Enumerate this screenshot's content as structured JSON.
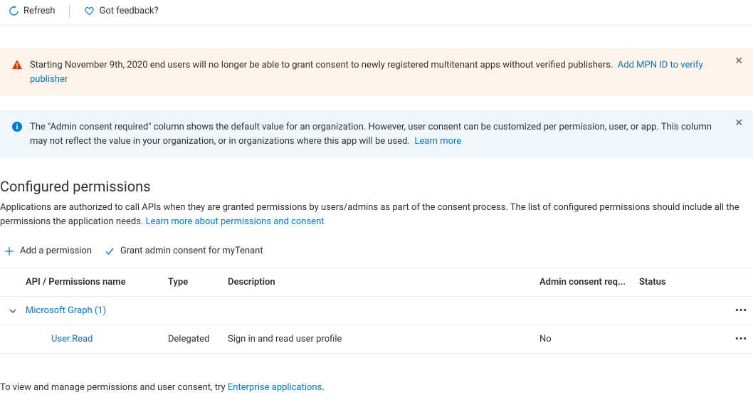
{
  "toolbar": {
    "refresh": "Refresh",
    "feedback": "Got feedback?"
  },
  "alerts": {
    "warning": {
      "text": "Starting November 9th, 2020 end users will no longer be able to grant consent to newly registered multitenant apps without verified publishers.",
      "link": "Add MPN ID to verify publisher"
    },
    "info": {
      "text": "The \"Admin consent required\" column shows the default value for an organization. However, user consent can be customized per permission, user, or app. This column may not reflect the value in your organization, or in organizations where this app will be used.",
      "link": "Learn more"
    }
  },
  "section": {
    "heading": "Configured permissions",
    "description": "Applications are authorized to call APIs when they are granted permissions by users/admins as part of the consent process. The list of configured permissions should include all the permissions the application needs.",
    "descLink": "Learn more about permissions and consent"
  },
  "actions": {
    "add": "Add a permission",
    "grant": "Grant admin consent for myTenant"
  },
  "table": {
    "headers": {
      "name": "API / Permissions name",
      "type": "Type",
      "desc": "Description",
      "adminreq": "Admin consent req...",
      "status": "Status"
    },
    "api": {
      "name": "Microsoft Graph (1)"
    },
    "perm": {
      "name": "User.Read",
      "type": "Delegated",
      "desc": "Sign in and read user profile",
      "adminreq": "No",
      "status": ""
    }
  },
  "footer": {
    "text": "To view and manage permissions and user consent, try ",
    "link": "Enterprise applications",
    "suffix": "."
  },
  "glyphs": {
    "times": "✕",
    "dots": "•••"
  }
}
